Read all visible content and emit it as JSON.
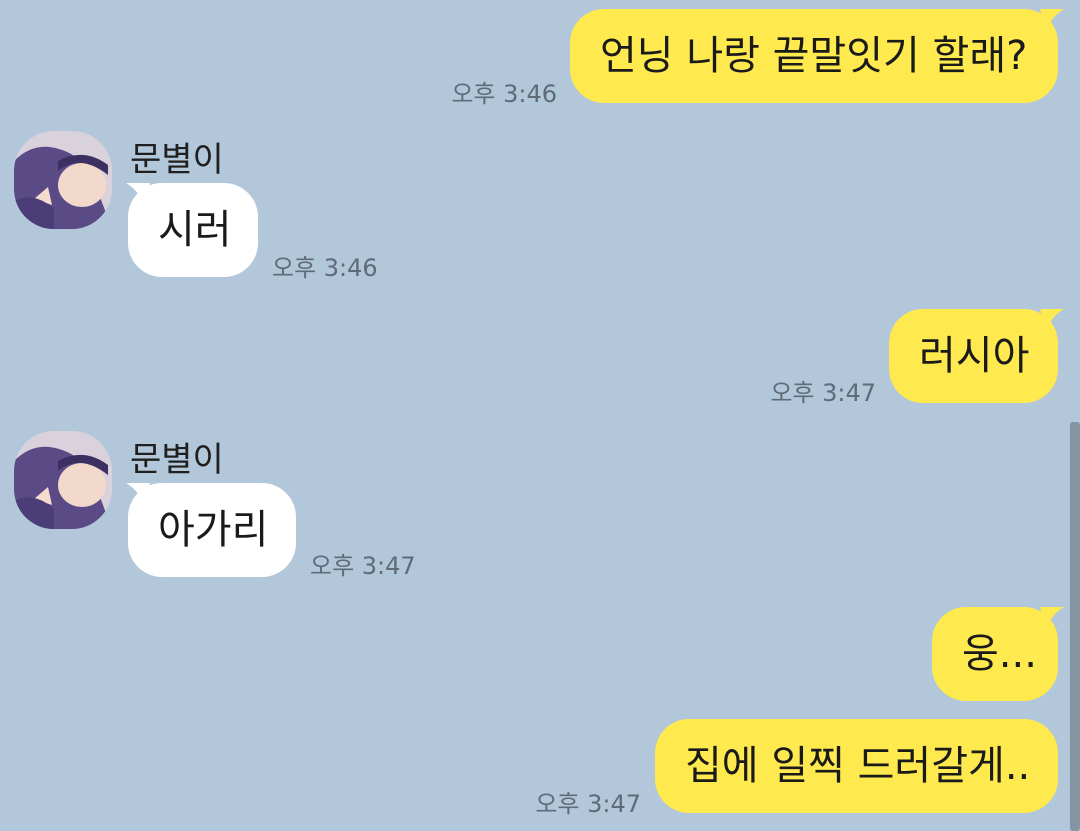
{
  "colors": {
    "background": "#b2c7da",
    "my_bubble": "#fee94e",
    "their_bubble": "#ffffff",
    "timestamp": "#5f6b78"
  },
  "contact": {
    "name": "문별이",
    "avatar_icon": "profile-photo-avatar"
  },
  "messages": [
    {
      "sender": "me",
      "text": "언닝 나랑 끝말잇기 할래?",
      "time": "오후 3:46"
    },
    {
      "sender": "them",
      "text": "시러",
      "time": "오후 3:46"
    },
    {
      "sender": "me",
      "text": "러시아",
      "time": "오후 3:47"
    },
    {
      "sender": "them",
      "text": "아가리",
      "time": "오후 3:47"
    },
    {
      "sender": "me",
      "text": "웅...",
      "time": ""
    },
    {
      "sender": "me",
      "text": "집에 일찍 드러갈게..",
      "time": "오후 3:47"
    }
  ]
}
